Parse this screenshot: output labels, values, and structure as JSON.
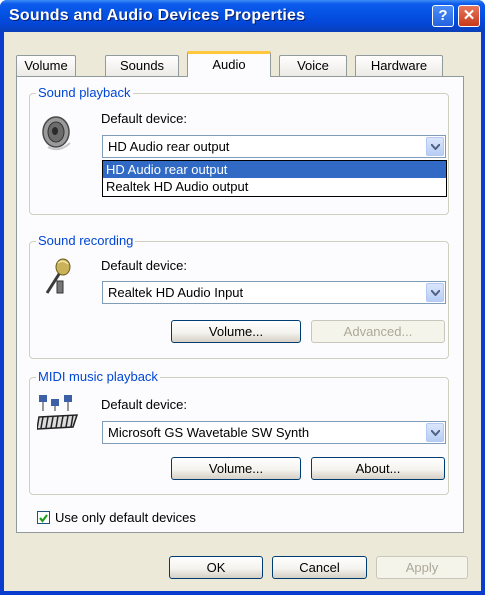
{
  "window": {
    "title": "Sounds and Audio Devices Properties",
    "help_glyph": "?",
    "close_glyph": "✕"
  },
  "tabs": [
    {
      "label": "Volume"
    },
    {
      "label": "Sounds"
    },
    {
      "label": "Audio",
      "active": true
    },
    {
      "label": "Voice"
    },
    {
      "label": "Hardware"
    }
  ],
  "playback": {
    "group_label": "Sound playback",
    "device_label": "Default device:",
    "selected_device": "HD Audio rear output",
    "options": [
      "HD Audio rear output",
      "Realtek HD Audio output"
    ],
    "icon": "speaker-icon"
  },
  "recording": {
    "group_label": "Sound recording",
    "device_label": "Default device:",
    "selected_device": "Realtek HD Audio Input",
    "volume_button": "Volume...",
    "advanced_button": "Advanced...",
    "icon": "microphone-icon"
  },
  "midi": {
    "group_label": "MIDI music playback",
    "device_label": "Default device:",
    "selected_device": "Microsoft GS Wavetable SW Synth",
    "volume_button": "Volume...",
    "about_button": "About...",
    "icon": "midi-keyboard-icon"
  },
  "use_default_only": {
    "label": "Use only default devices",
    "checked": true
  },
  "footer": {
    "ok": "OK",
    "cancel": "Cancel",
    "apply": "Apply"
  },
  "colors": {
    "title_bar": "#0553e5",
    "selection": "#316ac5",
    "group_label": "#0046d5",
    "dialog_bg": "#ece9d8"
  }
}
